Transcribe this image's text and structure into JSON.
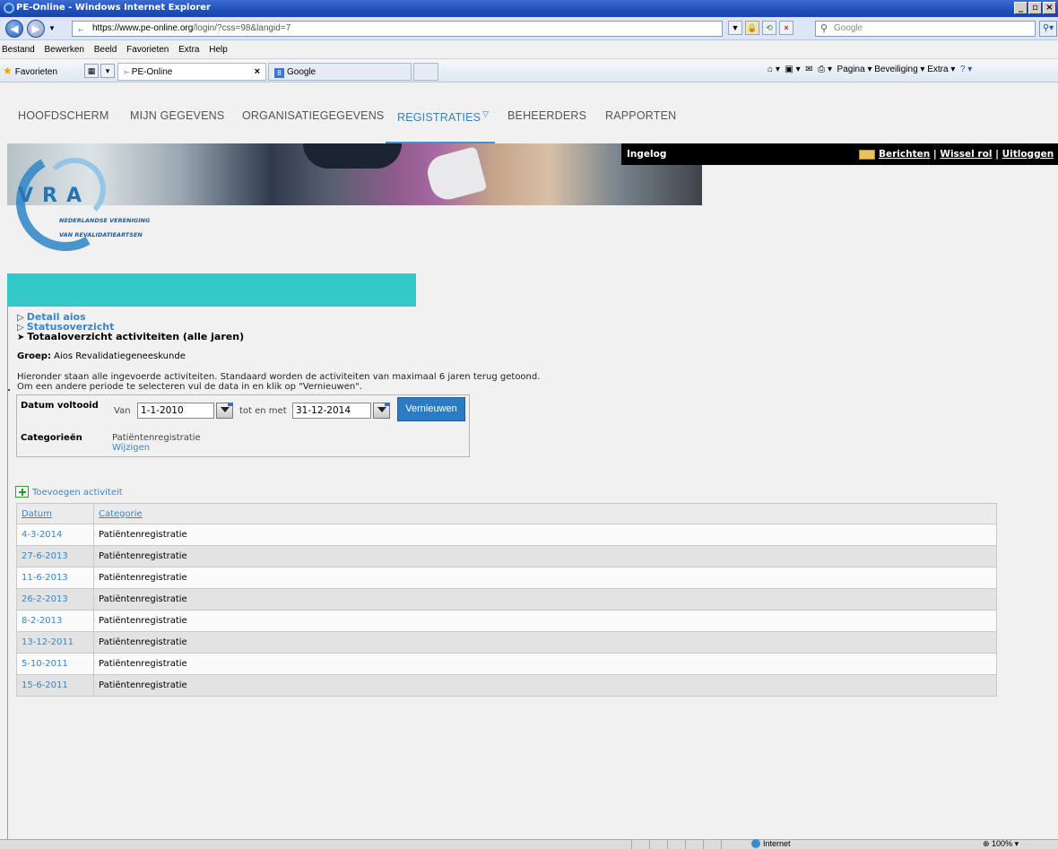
{
  "browser": {
    "window_title": "PE-Online - Windows Internet Explorer",
    "url_host": "https://www.pe-online.org",
    "url_rest": "/login/?css=98&langid=7",
    "search_placeholder": "Google",
    "menu": [
      "Bestand",
      "Bewerken",
      "Beeld",
      "Favorieten",
      "Extra",
      "Help"
    ],
    "favorites_label": "Favorieten",
    "tab_active": "PE-Online",
    "tab_second": "Google",
    "command_bar": "Pagina ▾   Beveiliging ▾   Extra ▾",
    "status_zone": "Internet",
    "status_zoom": "100%"
  },
  "nav": {
    "items": [
      "HOOFDSCHERM",
      "MIJN GEGEVENS",
      "ORGANISATIEGEGEVENS",
      "REGISTRATIES",
      "BEHEERDERS",
      "RAPPORTEN"
    ],
    "active_index": 3
  },
  "logo": {
    "letters": "VRA",
    "org_line1": "NEDERLANDSE VERENIGING",
    "org_line2": "VAN REVALIDATIEARTSEN"
  },
  "userbar": {
    "logged_in_label": "Ingelog",
    "links": [
      "Berichten",
      "Wissel rol",
      "Uitloggen"
    ],
    "separator": " | "
  },
  "breadcrumbs": [
    {
      "label": "Detail aios",
      "current": false
    },
    {
      "label": "Statusoverzicht",
      "current": false
    },
    {
      "label": "Totaaloverzicht activiteiten (alle jaren)",
      "current": true
    }
  ],
  "group": {
    "label": "Groep:",
    "value": "Aios Revalidatiegeneeskunde"
  },
  "intro": {
    "line1": "Hieronder staan alle ingevoerde activiteiten. Standaard worden de activiteiten van maximaal 6 jaren terug getoond.",
    "line2": "Om een andere periode te selecteren vul de data in en klik op \"Vernieuwen\"."
  },
  "filter": {
    "date_label": "Datum voltooid",
    "from_label": "Van",
    "from_value": "1-1-2010",
    "to_label": "tot en met",
    "to_value": "31-12-2014",
    "refresh_button": "Vernieuwen",
    "categories_label": "Categorieën",
    "categories_value": "Patiëntenregistratie",
    "change_link": "Wijzigen"
  },
  "add_activity": "Toevoegen activiteit",
  "table": {
    "headers": [
      "Datum",
      "Categorie"
    ],
    "rows": [
      {
        "date": "4-3-2014",
        "category": "Patiëntenregistratie"
      },
      {
        "date": "27-6-2013",
        "category": "Patiëntenregistratie"
      },
      {
        "date": "11-6-2013",
        "category": "Patiëntenregistratie"
      },
      {
        "date": "26-2-2013",
        "category": "Patiëntenregistratie"
      },
      {
        "date": "8-2-2013",
        "category": "Patiëntenregistratie"
      },
      {
        "date": "13-12-2011",
        "category": "Patiëntenregistratie"
      },
      {
        "date": "5-10-2011",
        "category": "Patiëntenregistratie"
      },
      {
        "date": "15-6-2011",
        "category": "Patiëntenregistratie"
      }
    ]
  },
  "colors": {
    "accent_link": "#3a86c4",
    "teal_bar": "#33c9c9",
    "button_blue": "#2a7cc4"
  }
}
